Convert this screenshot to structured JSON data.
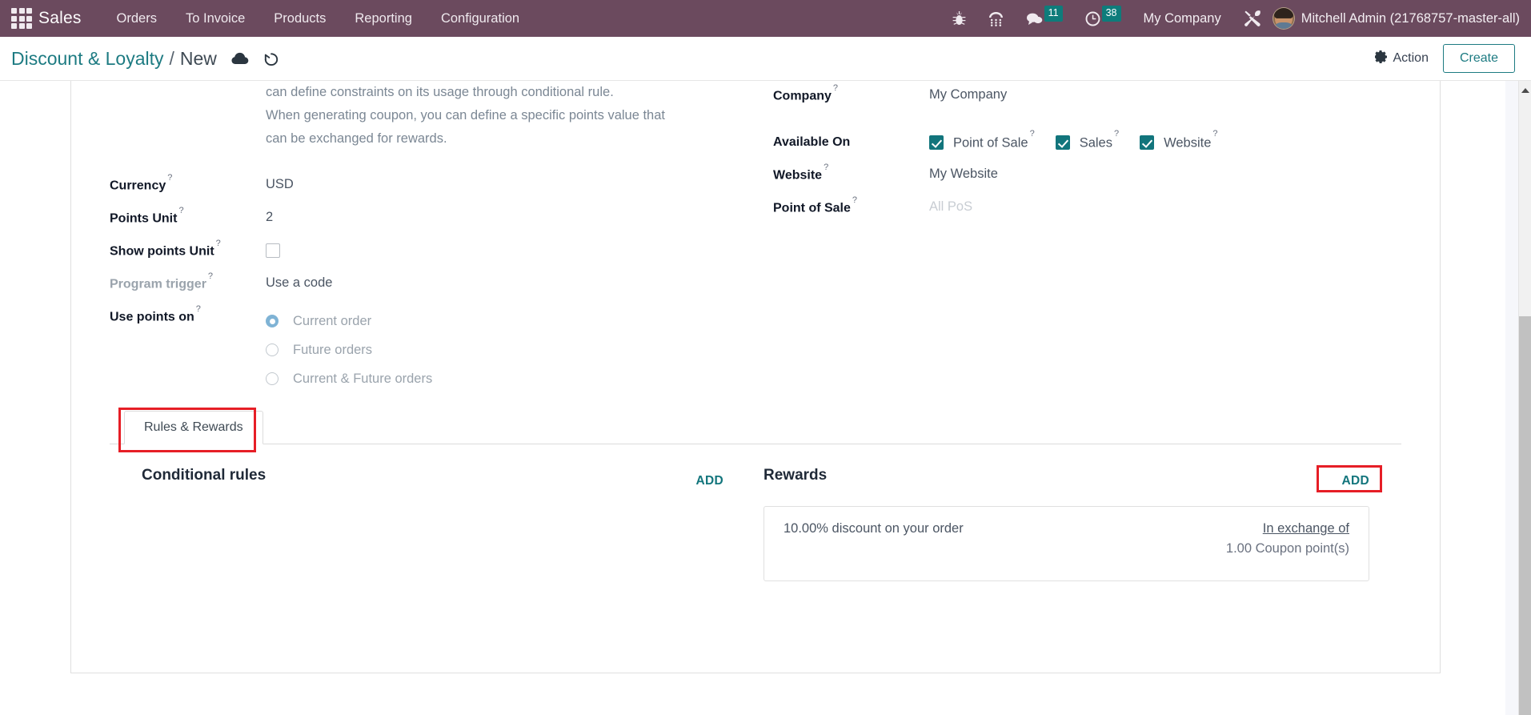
{
  "navbar": {
    "apps_icon": "apps-grid-icon",
    "brand": "Sales",
    "menu": [
      {
        "label": "Orders"
      },
      {
        "label": "To Invoice"
      },
      {
        "label": "Products"
      },
      {
        "label": "Reporting"
      },
      {
        "label": "Configuration"
      }
    ],
    "icons": [
      {
        "name": "bug-icon",
        "badge": null
      },
      {
        "name": "dialpad-icon",
        "badge": null
      },
      {
        "name": "messages-icon",
        "badge": "11"
      },
      {
        "name": "activities-clock-icon",
        "badge": "38"
      }
    ],
    "company": "My Company",
    "tools_icon": "tools-icon",
    "user": "Mitchell Admin (21768757-master-all)",
    "bg_color": "#6b4a5e",
    "badge_color": "#0e7c7b"
  },
  "control_panel": {
    "breadcrumb_root": "Discount & Loyalty",
    "breadcrumb_sep": "/",
    "breadcrumb_current": "New",
    "save_icon": "cloud-upload-icon",
    "discard_icon": "undo-icon",
    "action_label": "Action",
    "action_icon": "gear-icon",
    "create_label": "Create",
    "accent_color": "#1d7b82"
  },
  "form": {
    "help_text": [
      "can define constraints on its usage through conditional rule.",
      "When generating coupon, you can define a specific points value that",
      "can be exchanged for rewards."
    ],
    "left_fields": [
      {
        "label": "Currency",
        "help": "?",
        "value": "USD",
        "muted_label": false,
        "muted_value": false
      },
      {
        "label": "Points Unit",
        "help": "?",
        "value": "2",
        "muted_label": false,
        "muted_value": false
      },
      {
        "label": "Show points Unit",
        "help": "?",
        "value": "",
        "muted_label": false,
        "muted_value": false
      },
      {
        "label": "Program trigger",
        "help": "?",
        "value": "Use a code",
        "muted_label": true,
        "muted_value": false
      },
      {
        "label": "Use points on",
        "help": "?",
        "value": "",
        "muted_label": false,
        "muted_value": false
      }
    ],
    "show_points_unit_checked": false,
    "use_points_on": {
      "options": [
        {
          "label": "Current order",
          "selected": true
        },
        {
          "label": "Future orders",
          "selected": false
        },
        {
          "label": "Current & Future orders",
          "selected": false
        }
      ]
    },
    "right_fields": {
      "company_label": "Company",
      "company_value": "My Company",
      "available_on_label": "Available On",
      "available_on": [
        {
          "label": "Point of Sale",
          "checked": true
        },
        {
          "label": "Sales",
          "checked": true
        },
        {
          "label": "Website",
          "checked": true
        }
      ],
      "website_label": "Website",
      "website_value": "My Website",
      "pos_label": "Point of Sale",
      "pos_placeholder": "All PoS",
      "help": "?"
    }
  },
  "notebook": {
    "tabs": [
      {
        "label": "Rules & Rewards",
        "active": true,
        "highlighted": true
      }
    ],
    "conditional_rules": {
      "title": "Conditional rules",
      "add_label": "ADD",
      "highlighted": false,
      "items": []
    },
    "rewards": {
      "title": "Rewards",
      "add_label": "ADD",
      "highlighted": true,
      "items": [
        {
          "description": "10.00% discount on your order",
          "exchange_label": "In exchange of",
          "points": "1.00 Coupon point(s)"
        }
      ]
    },
    "highlight_color": "#e61e26"
  }
}
